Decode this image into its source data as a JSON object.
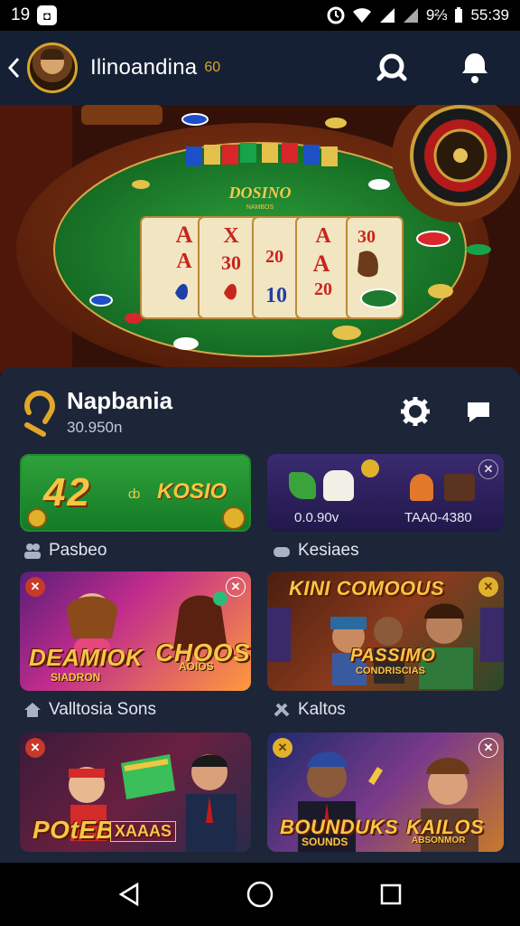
{
  "status": {
    "time": "19",
    "right_text": "9⅔",
    "right_clock": "55:39"
  },
  "header": {
    "username": "Ilinoandina",
    "username_suffix": "60"
  },
  "hero": {
    "table_label": "DOSINO",
    "table_sublabel": "NAMBOS",
    "cards": [
      {
        "top": "A",
        "mid": "A",
        "bottom": ""
      },
      {
        "top": "X",
        "mid": "30",
        "bottom": ""
      },
      {
        "top": "",
        "mid": "20",
        "bottom": "10"
      },
      {
        "top": "A",
        "mid": "A",
        "bottom": "20"
      },
      {
        "top": "30",
        "mid": "",
        "bottom": ""
      }
    ]
  },
  "profile": {
    "name": "Napbania",
    "sub": "30.950n"
  },
  "tiles": {
    "green": {
      "big": "42",
      "mid": "ȸ",
      "label": "KOSIO"
    },
    "purple": {
      "left_caption": "0.0.90v",
      "right_caption": "TAA0-4380"
    }
  },
  "sections": {
    "s1_left": "Pasbeo",
    "s1_right": "Kesiaes",
    "s2_left": "Valltosia Sons",
    "s2_right": "Kaltos"
  },
  "games": [
    {
      "title": "DEAMIOK",
      "sub": "SIADRON",
      "title2": "CHOOS",
      "sub2": "AOIOS"
    },
    {
      "title": "KINI COMOOUS",
      "sub": "PASSIMO",
      "sub2": "CONDRISCIAS"
    },
    {
      "title": "POtEB",
      "sub": "XAAAS"
    },
    {
      "title": "BOUNDUKS",
      "sub": "SOUNDS",
      "title2": "KAILOS",
      "sub2": "ABSONMOR"
    }
  ],
  "colors": {
    "accent_gold": "#f6c648",
    "panel_bg": "#1d2538",
    "header_bg": "#152034",
    "felt_green": "#1e7a2e"
  }
}
